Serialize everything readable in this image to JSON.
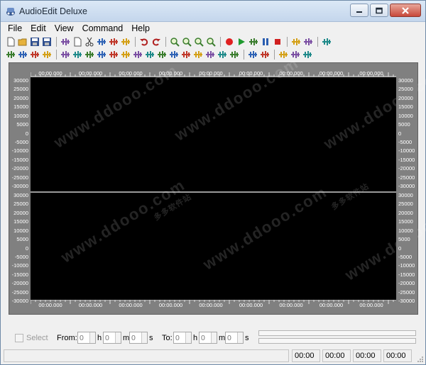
{
  "window": {
    "title": "AudioEdit Deluxe"
  },
  "menu": {
    "items": [
      "File",
      "Edit",
      "View",
      "Command",
      "Help"
    ]
  },
  "toolbar1": {
    "buttons": [
      "new-file-icon",
      "open-folder-icon",
      "save-icon",
      "save-as-icon",
      "convert-icon",
      "copy-icon",
      "cut-icon",
      "paste-icon",
      "trim-icon",
      "paste-mix-icon",
      "undo-icon",
      "redo-icon",
      "zoom-in-icon",
      "zoom-out-icon",
      "zoom-full-icon",
      "zoom-selection-icon",
      "record-icon",
      "play-icon",
      "play-from-cursor-icon",
      "pause-icon",
      "stop-icon",
      "volume-icon",
      "effects-icon",
      "options-icon"
    ]
  },
  "toolbar2": {
    "buttons": [
      "fade-in-icon",
      "fade-out-icon",
      "amplify-icon",
      "normalize-icon",
      "reverse-icon",
      "echo-icon",
      "insert-silence-icon",
      "mute-icon",
      "stretch-icon",
      "compress-icon",
      "pitch-up-icon",
      "pitch-down-icon",
      "vibrato-icon",
      "delay-icon",
      "equalizer-icon",
      "noise-reduce-icon",
      "invert-icon",
      "filter-icon",
      "mono-to-stereo-icon",
      "stereo-to-mono-icon",
      "split-channel-icon",
      "merge-channel-icon",
      "marker-icon",
      "region-icon"
    ]
  },
  "ruler": {
    "labels": [
      "00:00.000",
      "00:00.000",
      "00:00.000",
      "00:00.000",
      "00:00.000",
      "00:00.000",
      "00:00.000",
      "00:00.000",
      "00:00.000"
    ]
  },
  "scale": {
    "labels": [
      "30000",
      "25000",
      "20000",
      "15000",
      "10000",
      "5000",
      "0",
      "-5000",
      "-10000",
      "-15000",
      "-20000",
      "-25000",
      "-30000"
    ]
  },
  "watermark": {
    "url": "www.ddooo.com",
    "cn": "多多软件站"
  },
  "controls": {
    "select_label": "Select",
    "from_label": "From:",
    "to_label": "To:",
    "units": [
      "h",
      "m",
      "s"
    ],
    "from_values": [
      "0",
      "0",
      "0"
    ],
    "to_values": [
      "0",
      "0",
      "0"
    ]
  },
  "status": {
    "times": [
      "00:00",
      "00:00",
      "00:00",
      "00:00"
    ]
  },
  "colors": {
    "wave_bg": "#000000",
    "ruler_bg": "#808080",
    "titlebar": "#c4d6ec",
    "close_button": "#c8483a"
  }
}
